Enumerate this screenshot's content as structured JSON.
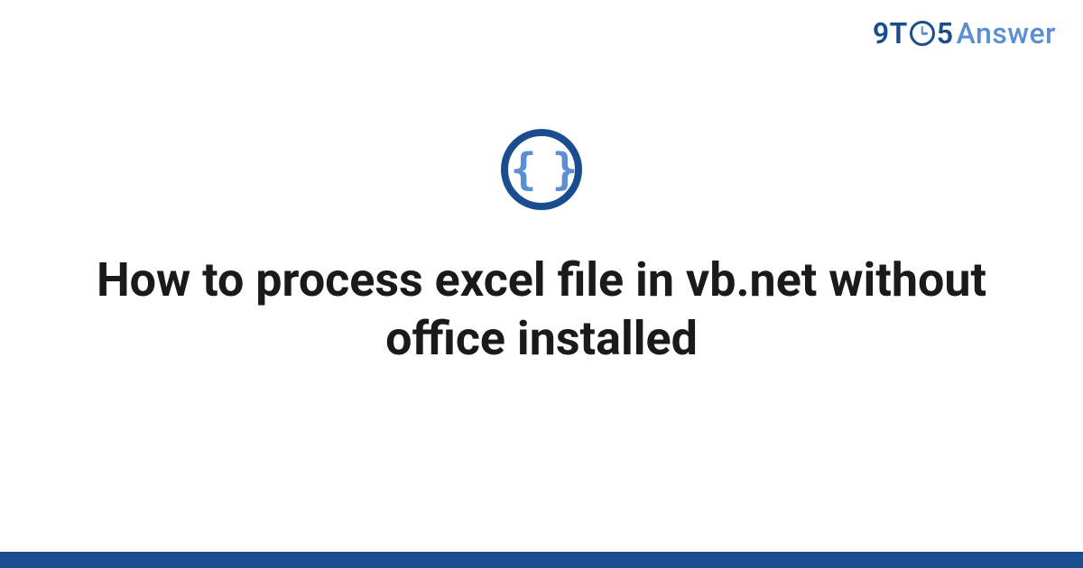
{
  "logo": {
    "part1": "9T",
    "part2": "5",
    "part3": "Answer"
  },
  "icon": {
    "glyph": "{ }",
    "name": "code-braces-icon"
  },
  "title": "How to process excel file in vb.net without office installed",
  "colors": {
    "primary": "#1a4d8f",
    "accent": "#5a8fd4",
    "text": "#1a1a1a",
    "background": "#ffffff"
  }
}
